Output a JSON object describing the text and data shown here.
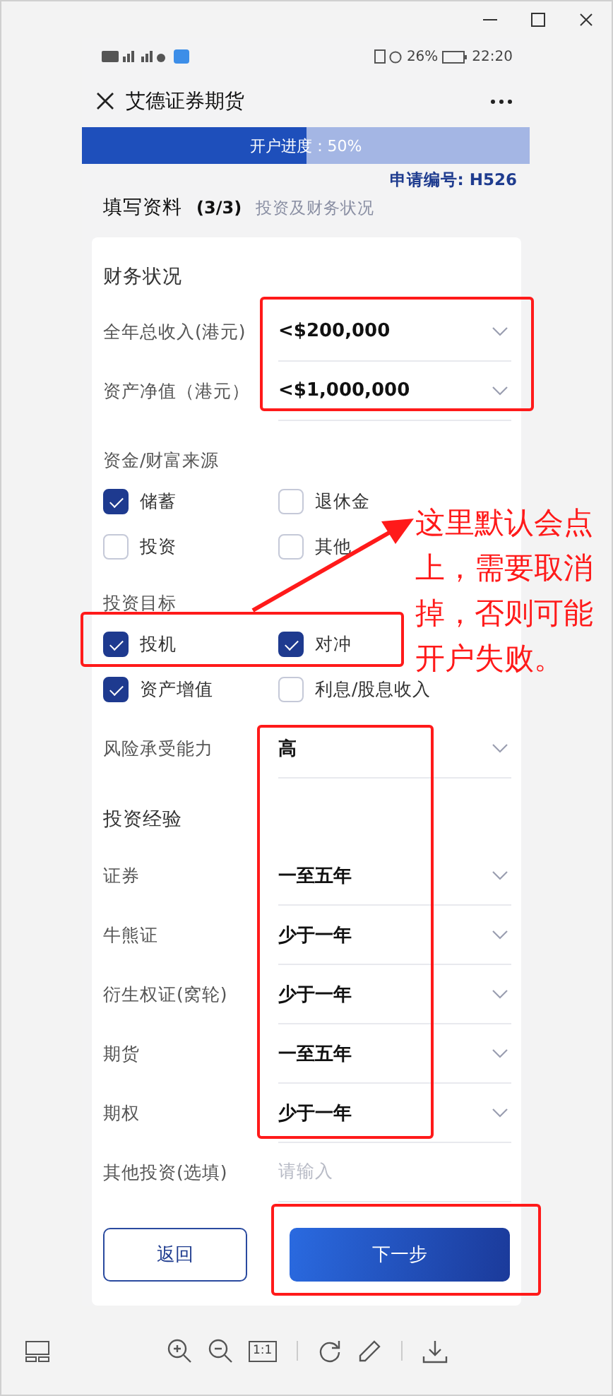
{
  "status_bar": {
    "battery": "26%",
    "time": "22:20"
  },
  "nav": {
    "title": "艾德证券期货"
  },
  "progress": {
    "label": "开户进度：50%",
    "level": 0.5
  },
  "application_no": "申请编号: H526",
  "step": {
    "title": "填写资料",
    "count": "(3/3)",
    "subtitle": "投资及财务状况"
  },
  "blocks": [
    {
      "kind": "heading",
      "text": "财务状况"
    },
    {
      "kind": "select",
      "label": "全年总收入(港元)",
      "value": "<$200,000"
    },
    {
      "kind": "select",
      "label": "资产净值（港元）",
      "value": "<$1,000,000"
    },
    {
      "kind": "group",
      "label": "资金/财富来源",
      "options": [
        {
          "label": "储蓄",
          "checked": true
        },
        {
          "label": "退休金",
          "checked": false
        },
        {
          "label": "投资",
          "checked": false
        },
        {
          "label": "其他",
          "checked": false
        }
      ]
    },
    {
      "kind": "group",
      "label": "投资目标",
      "options": [
        {
          "label": "投机",
          "checked": true
        },
        {
          "label": "对冲",
          "checked": true
        },
        {
          "label": "资产增值",
          "checked": true
        },
        {
          "label": "利息/股息收入",
          "checked": false
        }
      ]
    },
    {
      "kind": "select",
      "label": "风险承受能力",
      "value": "高"
    },
    {
      "kind": "heading",
      "text": "投资经验"
    },
    {
      "kind": "select",
      "label": "证券",
      "value": "一至五年"
    },
    {
      "kind": "select",
      "label": "牛熊证",
      "value": "少于一年"
    },
    {
      "kind": "select",
      "label": "衍生权证(窝轮)",
      "value": "少于一年"
    },
    {
      "kind": "select",
      "label": "期货",
      "value": "一至五年"
    },
    {
      "kind": "select",
      "label": "期权",
      "value": "少于一年"
    },
    {
      "kind": "input",
      "label": "其他投资(选填)",
      "placeholder": "请输入"
    }
  ],
  "buttons": {
    "back": "返回",
    "next": "下一步"
  },
  "annotation": {
    "note": "这里默认会点上，需要取消掉，否则可能开户失败。"
  },
  "toolbar": {
    "actual_size": "1:1"
  }
}
